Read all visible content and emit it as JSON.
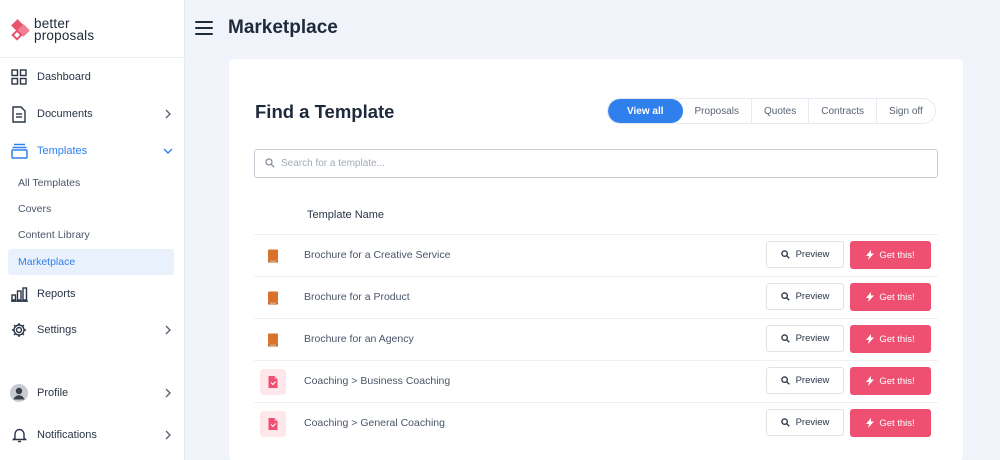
{
  "brand": {
    "name_line1": "better",
    "name_line2": "proposals",
    "accent": "#ef5072",
    "primary": "#2f80ed"
  },
  "sidebar": {
    "items": [
      {
        "label": "Dashboard",
        "icon": "grid-icon"
      },
      {
        "label": "Documents",
        "icon": "document-icon"
      },
      {
        "label": "Templates",
        "icon": "layers-icon"
      },
      {
        "label": "Reports",
        "icon": "bar-chart-icon"
      },
      {
        "label": "Settings",
        "icon": "gear-icon"
      },
      {
        "label": "Profile",
        "icon": "avatar"
      },
      {
        "label": "Notifications",
        "icon": "bell-icon"
      }
    ],
    "template_subitems": [
      "All Templates",
      "Covers",
      "Content Library",
      "Marketplace"
    ],
    "active_subitem": "Marketplace"
  },
  "header": {
    "title": "Marketplace"
  },
  "main": {
    "title": "Find a Template",
    "filters": [
      "View all",
      "Proposals",
      "Quotes",
      "Contracts",
      "Sign off"
    ],
    "active_filter": "View all",
    "search": {
      "placeholder": "Search for a template...",
      "value": ""
    },
    "column_header": "Template Name",
    "preview_label": "Preview",
    "get_label": "Get this!",
    "templates": [
      {
        "name": "Brochure for a Creative Service",
        "icon": "book-icon"
      },
      {
        "name": "Brochure for a Product",
        "icon": "book-icon"
      },
      {
        "name": "Brochure for an Agency",
        "icon": "book-icon"
      },
      {
        "name": "Coaching > Business Coaching",
        "icon": "file-icon"
      },
      {
        "name": "Coaching > General Coaching",
        "icon": "file-icon"
      }
    ]
  }
}
